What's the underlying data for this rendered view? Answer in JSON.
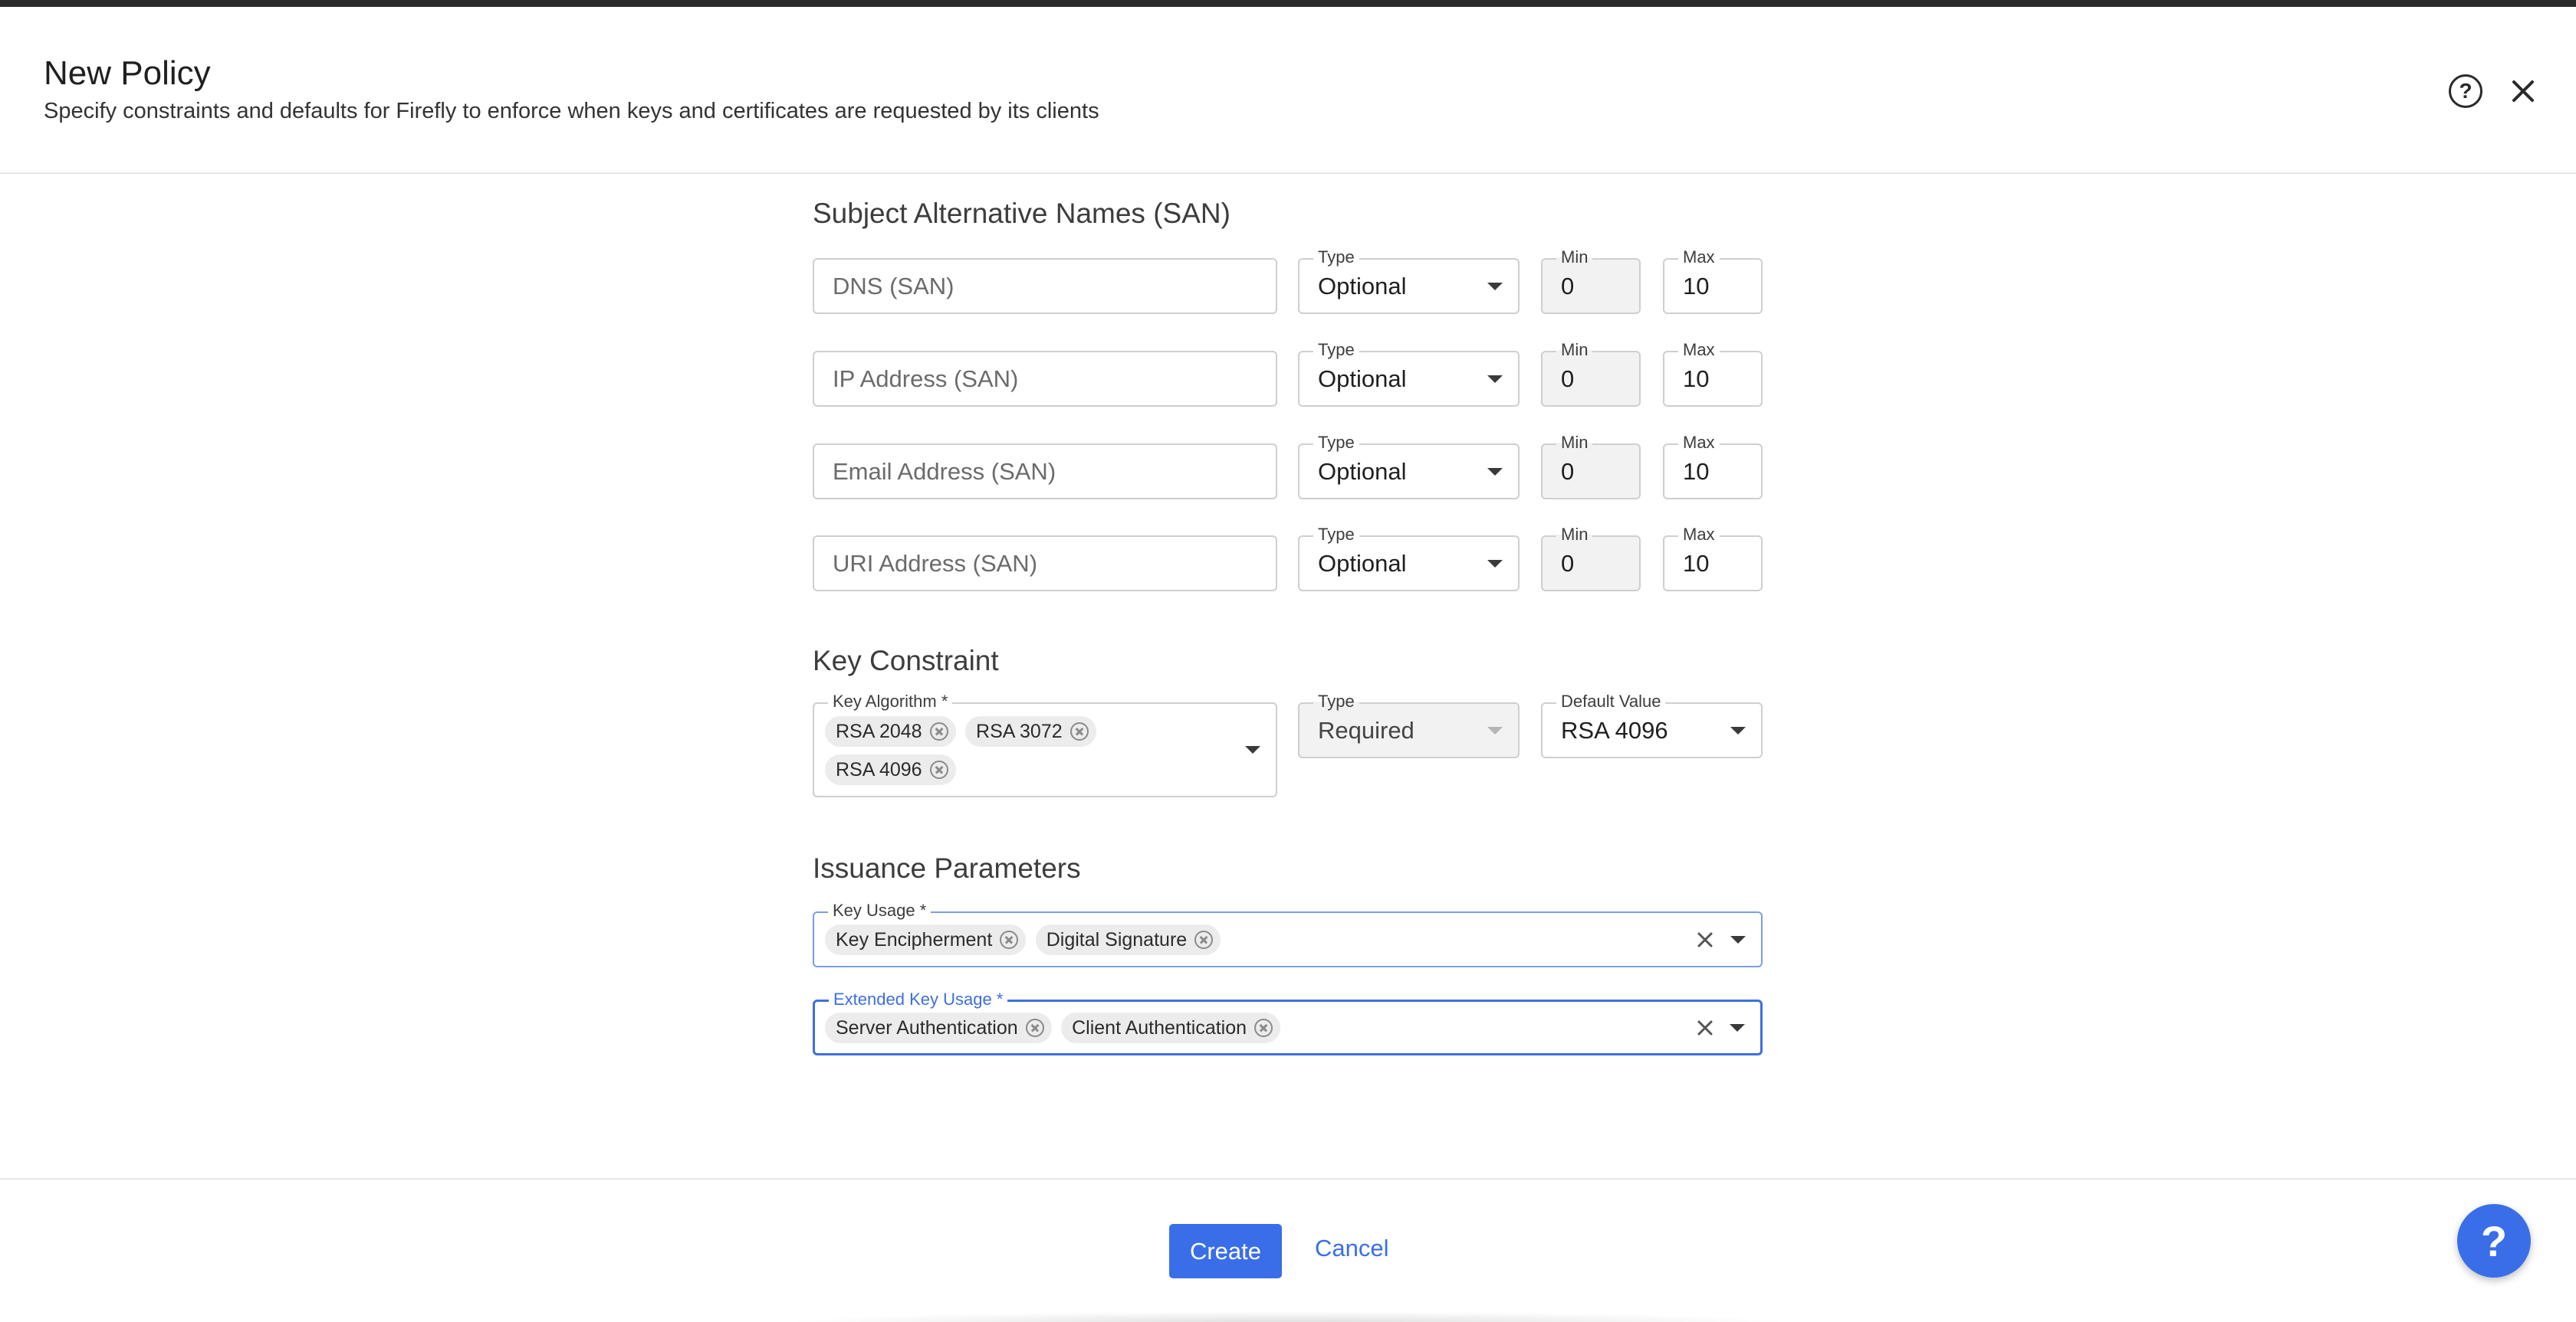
{
  "header": {
    "title": "New Policy",
    "subtitle": "Specify constraints and defaults for Firefly to enforce when keys and certificates are requested by its clients",
    "help_icon": "?"
  },
  "san": {
    "section_title": "Subject Alternative Names (SAN)",
    "rows": [
      {
        "placeholder": "DNS (SAN)",
        "type_label": "Type",
        "type_value": "Optional",
        "min_label": "Min",
        "min_value": "0",
        "max_label": "Max",
        "max_value": "10"
      },
      {
        "placeholder": "IP Address (SAN)",
        "type_label": "Type",
        "type_value": "Optional",
        "min_label": "Min",
        "min_value": "0",
        "max_label": "Max",
        "max_value": "10"
      },
      {
        "placeholder": "Email Address (SAN)",
        "type_label": "Type",
        "type_value": "Optional",
        "min_label": "Min",
        "min_value": "0",
        "max_label": "Max",
        "max_value": "10"
      },
      {
        "placeholder": "URI Address (SAN)",
        "type_label": "Type",
        "type_value": "Optional",
        "min_label": "Min",
        "min_value": "0",
        "max_label": "Max",
        "max_value": "10"
      }
    ]
  },
  "key_constraint": {
    "section_title": "Key Constraint",
    "algorithm_label": "Key Algorithm *",
    "algorithms": [
      "RSA 2048",
      "RSA 3072",
      "RSA 4096"
    ],
    "type_label": "Type",
    "type_value": "Required",
    "default_label": "Default Value",
    "default_value": "RSA 4096"
  },
  "issuance": {
    "section_title": "Issuance Parameters",
    "key_usage_label": "Key Usage *",
    "key_usage": [
      "Key Encipherment",
      "Digital Signature"
    ],
    "ext_key_usage_label": "Extended Key Usage *",
    "ext_key_usage": [
      "Server Authentication",
      "Client Authentication"
    ]
  },
  "footer": {
    "create_label": "Create",
    "cancel_label": "Cancel",
    "fab_label": "?"
  },
  "colors": {
    "accent": "#3a6ee8",
    "focus_border": "#3d6fe0"
  }
}
